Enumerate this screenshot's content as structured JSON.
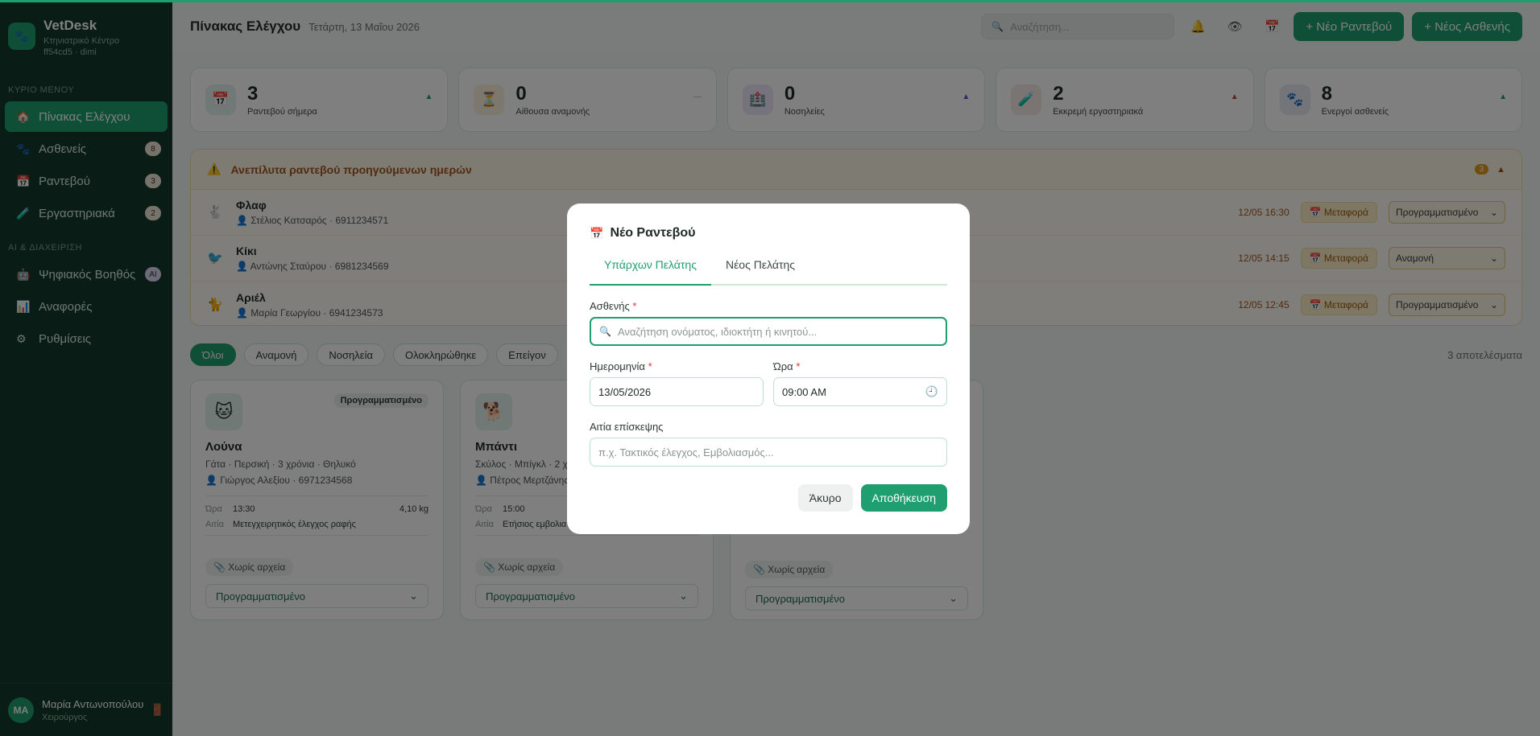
{
  "brand": {
    "title": "VetDesk",
    "subtitle": "Κτηνιατρικό Κέντρο",
    "meta": "ff54cd5 · dimi"
  },
  "sidebar": {
    "section_main": "ΚΥΡΙΟ ΜΕΝΟΥ",
    "section_ai": "AI & ΔΙΑΧΕΙΡΙΣΗ",
    "main_items": [
      {
        "label": "Πίνακας Ελέγχου",
        "icon": "home-icon",
        "badge": ""
      },
      {
        "label": "Ασθενείς",
        "icon": "paw-icon",
        "badge": "8"
      },
      {
        "label": "Ραντεβού",
        "icon": "calendar-icon",
        "badge": "3"
      },
      {
        "label": "Εργαστηριακά",
        "icon": "test-tube-icon",
        "badge": "2"
      }
    ],
    "ai_items": [
      {
        "label": "Ψηφιακός Βοηθός",
        "icon": "robot-icon",
        "badge": "AI"
      },
      {
        "label": "Αναφορές",
        "icon": "bar-chart-icon",
        "badge": ""
      },
      {
        "label": "Ρυθμίσεις",
        "icon": "gear-icon",
        "badge": ""
      }
    ],
    "user": {
      "initials": "MA",
      "name": "Μαρία Αντωνοπούλου",
      "role": "Χειρούργος"
    }
  },
  "header": {
    "title": "Πίνακας Ελέγχου",
    "date": "Τετάρτη, 13 Μαΐου 2026",
    "search_placeholder": "Αναζήτηση...",
    "new_appointment": "+ Νέο Ραντεβού",
    "new_patient": "+ Νέος Ασθενής"
  },
  "stats": [
    {
      "value": "3",
      "label": "Ραντεβού σήμερα",
      "icon": "calendar-icon",
      "trend": "▲",
      "color": "#1f9e70",
      "bg": "#e2f3ec"
    },
    {
      "value": "0",
      "label": "Αίθουσα αναμονής",
      "icon": "hourglass-icon",
      "trend": "—",
      "color": "#9aa7a1",
      "bg": "#fbf0dc"
    },
    {
      "value": "0",
      "label": "Νοσηλείες",
      "icon": "hospital-icon",
      "trend": "▲",
      "color": "#6b4fd0",
      "bg": "#ece6f8"
    },
    {
      "value": "2",
      "label": "Εκκρεμή εργαστηριακά",
      "icon": "test-tube-icon",
      "trend": "▲",
      "color": "#c94040",
      "bg": "#f5e9e4"
    },
    {
      "value": "8",
      "label": "Ενεργοί ασθενείς",
      "icon": "paw-icon",
      "trend": "▲",
      "color": "#1f9e70",
      "bg": "#e8eaf3"
    }
  ],
  "overdue": {
    "title": "Ανεπίλυτα ραντεβού προηγούμενων ημερών",
    "count": "3",
    "rows": [
      {
        "name": "Φλαφ",
        "owner": "Στέλιος Κατσαρός · 6911234571",
        "time": "12/05 16:30",
        "tag": "Μεταφορά",
        "status": "Προγραμματισμένο",
        "icon": "rabbit-icon"
      },
      {
        "name": "Κίκι",
        "owner": "Αντώνης Σταύρου · 6981234569",
        "time": "12/05 14:15",
        "tag": "Μεταφορά",
        "status": "Αναμονή",
        "icon": "bird-icon"
      },
      {
        "name": "Αριέλ",
        "owner": "Μαρία Γεωργίου · 6941234573",
        "time": "12/05 12:45",
        "tag": "Μεταφορά",
        "status": "Προγραμματισμένο",
        "icon": "cat-icon"
      }
    ]
  },
  "filters": [
    "Όλοι",
    "Αναμονή",
    "Νοσηλεία",
    "Ολοκληρώθηκε",
    "Επείγον"
  ],
  "result_count": "3 αποτελέσματα",
  "cards": [
    {
      "name": "Λούνα",
      "desc": "Γάτα · Περσική · 3 χρόνια · Θηλυκό",
      "owner": "Γιώργος Αλεξίου · 6971234568",
      "status": "Προγραμματισμένο",
      "time_label": "Ώρα",
      "time": "13:30",
      "weight": "4,10 kg",
      "reason_label": "Αιτία",
      "reason": "Μετεγχειρητικός έλεγχος ραφής",
      "files": "Χωρίς αρχεία",
      "select": "Προγραμματισμένο",
      "icon": "cat-icon"
    },
    {
      "name": "Μπάντι",
      "desc": "Σκύλος · Μπίγκλ · 2 χρ",
      "owner": "Πέτρος Μερτζάνης",
      "status": "",
      "time_label": "Ώρα",
      "time": "15:00",
      "weight": "",
      "reason_label": "Αιτία",
      "reason": "Ετήσιος εμβολια",
      "files": "Χωρίς αρχεία",
      "select": "Προγραμματισμένο",
      "icon": "dog-icon"
    },
    {
      "name": "",
      "desc": "",
      "owner": "",
      "status": "",
      "time_label": "",
      "time": "",
      "weight": "",
      "reason_label": "",
      "reason": "",
      "files": "Χωρίς αρχεία",
      "select": "Προγραμματισμένο",
      "icon": ""
    }
  ],
  "modal": {
    "title": "Νέο Ραντεβού",
    "tabs": [
      "Υπάρχων Πελάτης",
      "Νέος Πελάτης"
    ],
    "patient_label": "Ασθενής",
    "patient_placeholder": "Αναζήτηση ονόματος, ιδιοκτήτη ή κινητού...",
    "date_label": "Ημερομηνία",
    "date_value": "13/05/2026",
    "time_label": "Ώρα",
    "time_value": "09:00 AM",
    "reason_label": "Αιτία επίσκεψης",
    "reason_placeholder": "π.χ. Τακτικός έλεγχος, Εμβολιασμός...",
    "cancel": "Άκυρο",
    "save": "Αποθήκευση",
    "required_mark": "*"
  }
}
